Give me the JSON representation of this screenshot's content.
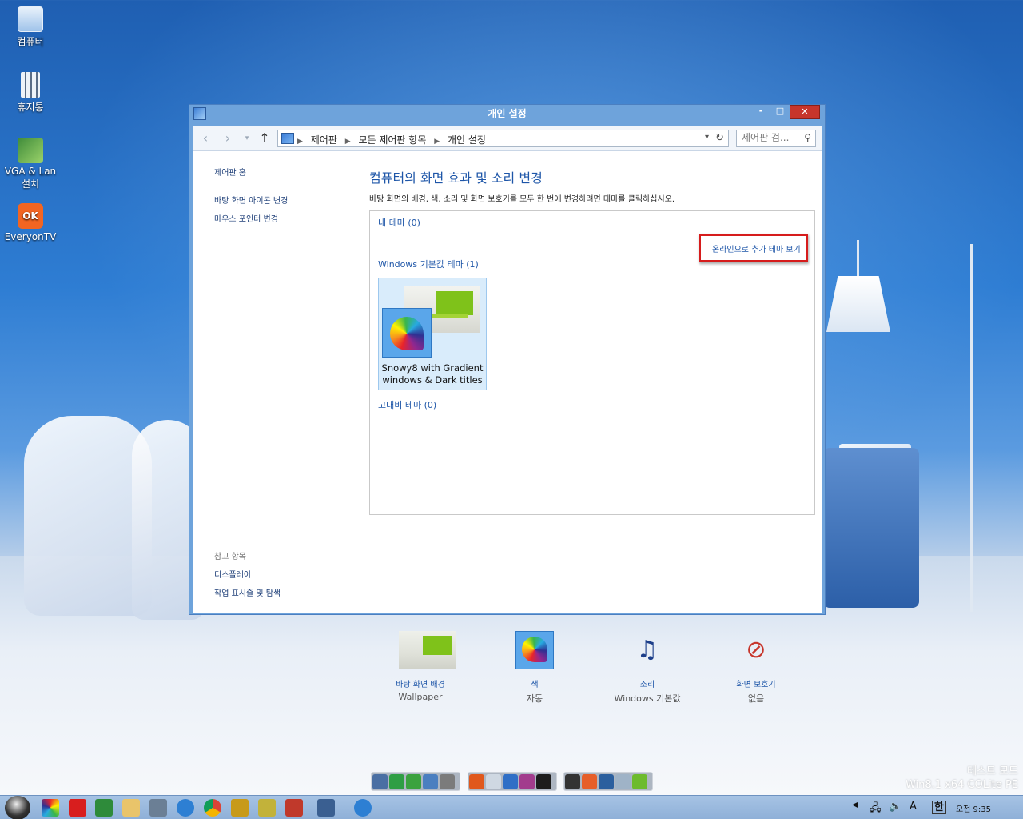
{
  "desktop": {
    "icons": [
      {
        "label": "컴퓨터",
        "icon": "computer-icon"
      },
      {
        "label": "휴지통",
        "icon": "recycle-bin-icon"
      },
      {
        "label": "VGA & Lan 설치",
        "icon": "driver-install-icon"
      },
      {
        "label": "EveryonTV",
        "icon": "everyontv-icon"
      }
    ]
  },
  "window": {
    "title": "개인 설정",
    "controls": {
      "minimize": "-",
      "maximize": "□",
      "close": "✕"
    },
    "address": {
      "crumbs": [
        "제어판",
        "모든 제어판 항목",
        "개인 설정"
      ],
      "search_placeholder": "제어판 검..."
    },
    "left_pane": {
      "home": "제어판 홈",
      "links": [
        "바탕 화면 아이콘 변경",
        "마우스 포인터 변경"
      ],
      "see_also_header": "참고 항목",
      "see_also": [
        "디스플레이",
        "작업 표시줄 및 탐색"
      ]
    },
    "main": {
      "title": "컴퓨터의 화면 효과 및 소리 변경",
      "subtitle": "바탕 화면의 배경, 색, 소리 및 화면 보호기를 모두 한 번에 변경하려면 테마를 클릭하십시오.",
      "groups": {
        "my_themes": "내 테마 (0)",
        "online_link": "온라인으로 추가 테마 보기",
        "windows_default": "Windows 기본값 테마 (1)",
        "high_contrast": "고대비 테마 (0)"
      },
      "theme_card": {
        "name": "Snowy8 with Gradient windows & Dark titles"
      },
      "bottom": [
        {
          "link": "바탕 화면 배경",
          "value": "Wallpaper",
          "icon": "wallpaper-icon"
        },
        {
          "link": "색",
          "value": "자동",
          "icon": "color-palette-icon"
        },
        {
          "link": "소리",
          "value": "Windows 기본값",
          "icon": "sound-icon"
        },
        {
          "link": "화면 보호기",
          "value": "없음",
          "icon": "screensaver-icon"
        }
      ]
    }
  },
  "watermark": {
    "line1": "테스트 모드",
    "line2": "Win8.1 x64 COLite PE"
  },
  "taskbar": {
    "clock": "오전 9:35",
    "ime": "한",
    "lang": "A"
  }
}
